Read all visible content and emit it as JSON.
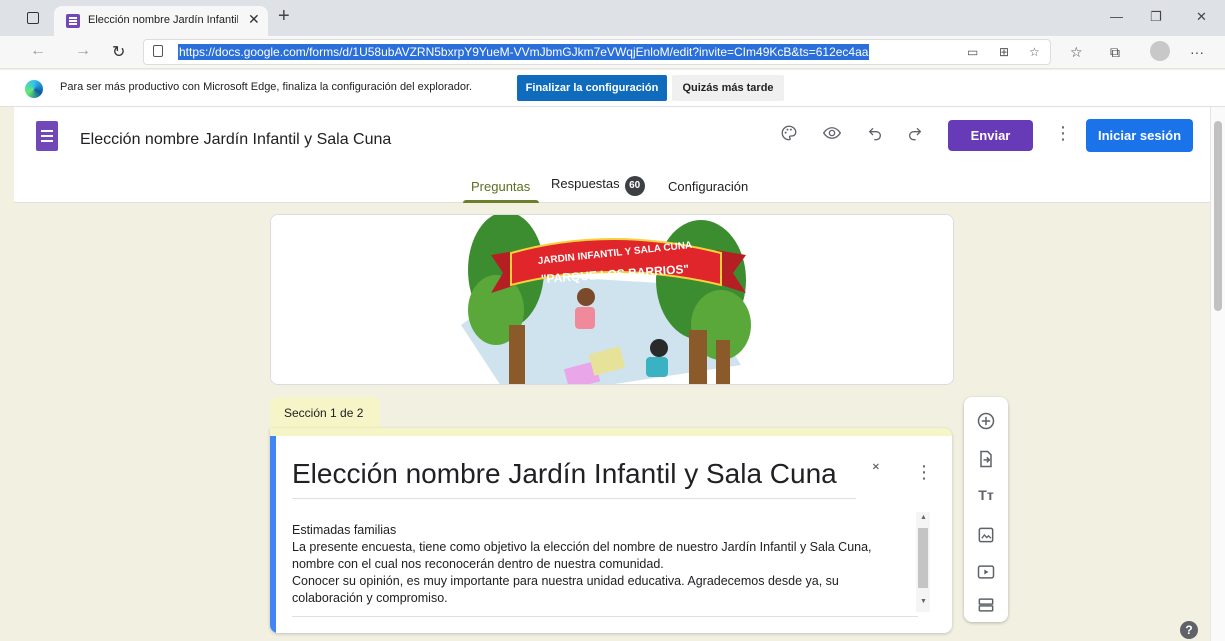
{
  "browser": {
    "tab_title": "Elección nombre Jardín Infantil y",
    "tab_close": "✕",
    "new_tab": "+",
    "url": "https://docs.google.com/forms/d/1U58ubAVZRN5bxrpY9YueM-VVmJbmGJkm7eVWqjEnloM/edit?invite=CIm49KcB&ts=612ec4aa",
    "window_controls": {
      "minimize": "—",
      "restore": "❐",
      "close": "✕"
    },
    "more_label": "···"
  },
  "infobar": {
    "message": "Para ser más productivo con Microsoft Edge, finaliza la configuración del explorador.",
    "primary_button": "Finalizar la configuración",
    "secondary_button": "Quizás más tarde"
  },
  "forms_header": {
    "title": "Elección nombre Jardín Infantil y Sala Cuna",
    "send_button": "Enviar",
    "login_button": "Iniciar sesión",
    "tabs": [
      {
        "label": "Preguntas",
        "active": true
      },
      {
        "label": "Respuestas",
        "active": false,
        "badge": "60"
      },
      {
        "label": "Configuración",
        "active": false
      }
    ]
  },
  "banner": {
    "line1": "JARDIN INFANTIL Y SALA CUNA",
    "line2": "\"PARQUE LOS BARRIOS\""
  },
  "section": {
    "tag": "Sección 1 de 2",
    "title": "Elección nombre Jardín Infantil y Sala Cuna",
    "description_lines": [
      "Estimadas familias",
      "La presente encuesta, tiene como objetivo la elección del nombre de nuestro Jardín Infantil y Sala Cuna,",
      "nombre con el cual nos reconocerán dentro de nuestra comunidad.",
      "Conocer su opinión, es muy importante para nuestra unidad educativa. Agradecemos desde ya, su",
      "colaboración y compromiso."
    ]
  },
  "floating_toolbar": {
    "items": [
      "add-question",
      "import-questions",
      "add-title",
      "add-image",
      "add-video",
      "add-section"
    ]
  },
  "help_label": "?",
  "colors": {
    "accent_purple": "#673ab7",
    "login_blue": "#1a73e8",
    "edge_blue": "#0f6cbd",
    "page_background": "#f2f0e1",
    "section_tag": "#f6f5c8",
    "active_tab": "#5b6f1f",
    "card_accent": "#4285f4"
  }
}
